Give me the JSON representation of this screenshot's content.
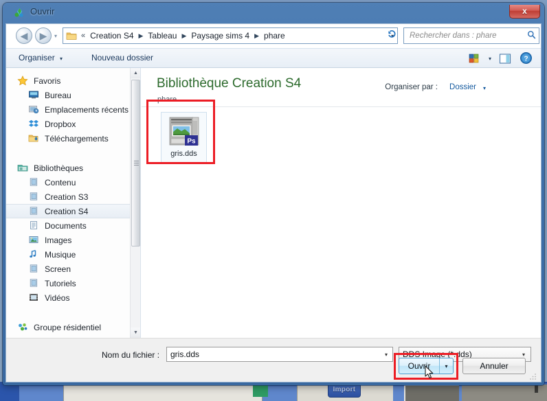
{
  "window": {
    "title": "Ouvrir",
    "title_icon": "sims4-plumbob-icon",
    "close_label": "x"
  },
  "navbar": {
    "back_icon": "arrow-left-icon",
    "forward_icon": "arrow-right-icon",
    "history_caret": "▾",
    "folder_icon": "folder-icon",
    "leading_chevron": "«",
    "breadcrumbs": [
      {
        "label": "Creation S4"
      },
      {
        "label": "Tableau"
      },
      {
        "label": "Paysage sims 4"
      },
      {
        "label": "phare"
      }
    ],
    "separator": "▶",
    "dropdown_caret": "▾",
    "refresh_icon": "refresh-icon",
    "search": {
      "placeholder": "Rechercher dans : phare",
      "value": "",
      "icon": "search-icon"
    }
  },
  "toolbar": {
    "organise_label": "Organiser",
    "organise_caret": "▾",
    "new_folder_label": "Nouveau dossier",
    "view_icon": "view-options-icon",
    "view_caret": "▾",
    "preview_pane_icon": "preview-pane-icon",
    "help_icon": "help-icon"
  },
  "sidebar": {
    "groups": [
      {
        "header": {
          "label": "Favoris",
          "icon": "star-icon"
        },
        "items": [
          {
            "label": "Bureau",
            "icon": "desktop-icon"
          },
          {
            "label": "Emplacements récents",
            "icon": "recent-places-icon"
          },
          {
            "label": "Dropbox",
            "icon": "dropbox-icon"
          },
          {
            "label": "Téléchargements",
            "icon": "downloads-icon"
          }
        ]
      },
      {
        "header": {
          "label": "Bibliothèques",
          "icon": "libraries-icon"
        },
        "items": [
          {
            "label": "Contenu",
            "icon": "library-icon",
            "selected": false
          },
          {
            "label": "Creation S3",
            "icon": "library-icon",
            "selected": false
          },
          {
            "label": "Creation S4",
            "icon": "library-icon",
            "selected": true
          },
          {
            "label": "Documents",
            "icon": "documents-library-icon",
            "selected": false
          },
          {
            "label": "Images",
            "icon": "pictures-library-icon",
            "selected": false
          },
          {
            "label": "Musique",
            "icon": "music-library-icon",
            "selected": false
          },
          {
            "label": "Screen",
            "icon": "library-icon",
            "selected": false
          },
          {
            "label": "Tutoriels",
            "icon": "library-icon",
            "selected": false
          },
          {
            "label": "Vidéos",
            "icon": "videos-library-icon",
            "selected": false
          }
        ]
      },
      {
        "header": {
          "label": "Groupe résidentiel",
          "icon": "homegroup-icon"
        },
        "items": []
      }
    ],
    "scrollbar": {
      "up_arrow": "▲",
      "down_arrow": "▼"
    }
  },
  "filepane": {
    "library_title": "Bibliothèque Creation S4",
    "library_subtitle": "phare",
    "organise_by_label": "Organiser par :",
    "organise_by_value": "Dossier",
    "organise_by_caret": "▾",
    "files": [
      {
        "name": "gris.dds",
        "thumbnail": "dds-image-thumbnail",
        "overlay_badge": "Ps",
        "selected": true
      }
    ]
  },
  "bottombar": {
    "filename_label": "Nom du fichier :",
    "filename_value": "gris.dds",
    "filename_caret": "▾",
    "filetype_value": "DDS Image (*.dds)",
    "filetype_caret": "▾",
    "open_button": "Ouvrir",
    "open_caret": "▾",
    "cancel_button": "Annuler"
  },
  "background": {
    "import_button": "Import"
  },
  "highlights": {
    "file_tile": "#ec1c24",
    "open_button": "#ec1c24"
  },
  "colors": {
    "titlebar_blue": "#3f6fa8",
    "library_title_green": "#2c6a2c",
    "link_blue": "#13599e",
    "highlight_red": "#ec1c24",
    "close_red": "#bf3c33"
  }
}
